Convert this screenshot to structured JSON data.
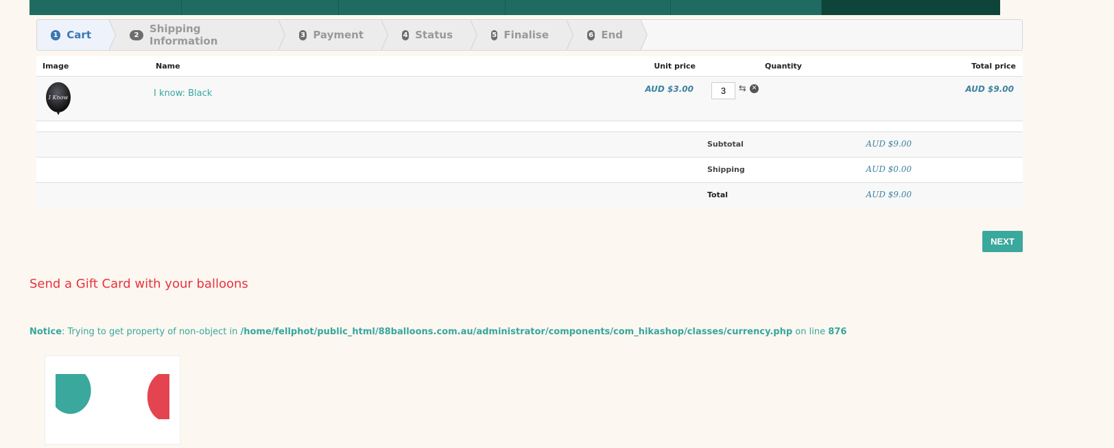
{
  "steps": [
    {
      "num": "1",
      "label": "Cart"
    },
    {
      "num": "2",
      "label": "Shipping Information"
    },
    {
      "num": "3",
      "label": "Payment"
    },
    {
      "num": "4",
      "label": "Status"
    },
    {
      "num": "5",
      "label": "Finalise"
    },
    {
      "num": "6",
      "label": "End"
    }
  ],
  "table": {
    "headers": {
      "image": "Image",
      "name": "Name",
      "unit_price": "Unit price",
      "quantity": "Quantity",
      "total_price": "Total price"
    },
    "item": {
      "image_text": "I Know",
      "name": "I know: Black",
      "unit_price": "AUD $3.00",
      "quantity": "3",
      "total_price": "AUD $9.00"
    },
    "summary": [
      {
        "label": "Subtotal",
        "value": "AUD $9.00"
      },
      {
        "label": "Shipping",
        "value": "AUD $0.00"
      },
      {
        "label": "Total",
        "value": "AUD $9.00"
      }
    ]
  },
  "next_label": "NEXT",
  "gift_heading": "Send a Gift Card with your balloons",
  "notice": {
    "label": "Notice",
    "message": ": Trying to get property of non-object in ",
    "path": "/home/fellphot/public_html/88balloons.com.au/administrator/components/com_hikashop/classes/currency.php",
    "on_line": " on line ",
    "line": "876"
  },
  "colors": {
    "accent": "#3aa89d",
    "heading": "#e8323c",
    "price": "#3d82a0",
    "topbar": "#1f6b61"
  }
}
